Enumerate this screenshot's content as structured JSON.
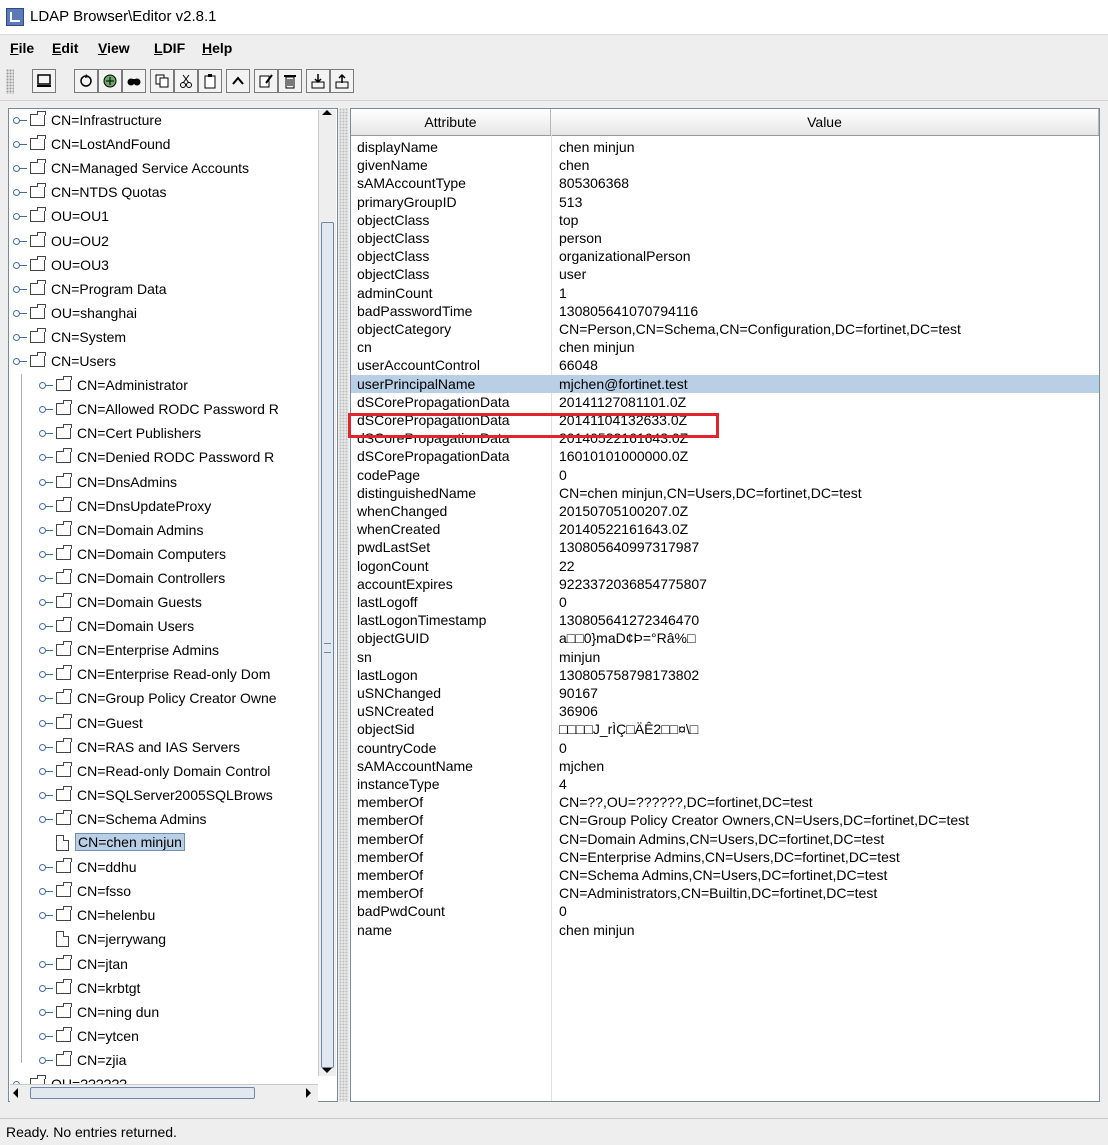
{
  "window": {
    "title": "LDAP Browser\\Editor v2.8.1"
  },
  "menu": [
    "File",
    "Edit",
    "View",
    "LDIF",
    "Help"
  ],
  "toolbar": {
    "buttons": [
      "computer-icon",
      "refresh-icon",
      "connect-icon",
      "search-icon",
      "copy-icon",
      "cut-icon",
      "paste-icon",
      "up-icon",
      "edit-icon",
      "delete-icon",
      "import-icon",
      "export-icon"
    ]
  },
  "tree": {
    "top": [
      "CN=Infrastructure",
      "CN=LostAndFound",
      "CN=Managed Service Accounts",
      "CN=NTDS Quotas",
      "OU=OU1",
      "OU=OU2",
      "OU=OU3",
      "CN=Program Data",
      "OU=shanghai",
      "CN=System",
      "CN=Users"
    ],
    "children": [
      {
        "label": "CN=Administrator",
        "type": "folder"
      },
      {
        "label": "CN=Allowed RODC Password R",
        "type": "folder"
      },
      {
        "label": "CN=Cert Publishers",
        "type": "folder"
      },
      {
        "label": "CN=Denied RODC Password R",
        "type": "folder"
      },
      {
        "label": "CN=DnsAdmins",
        "type": "folder"
      },
      {
        "label": "CN=DnsUpdateProxy",
        "type": "folder"
      },
      {
        "label": "CN=Domain Admins",
        "type": "folder"
      },
      {
        "label": "CN=Domain Computers",
        "type": "folder"
      },
      {
        "label": "CN=Domain Controllers",
        "type": "folder"
      },
      {
        "label": "CN=Domain Guests",
        "type": "folder"
      },
      {
        "label": "CN=Domain Users",
        "type": "folder"
      },
      {
        "label": "CN=Enterprise Admins",
        "type": "folder"
      },
      {
        "label": "CN=Enterprise Read-only Dom",
        "type": "folder"
      },
      {
        "label": "CN=Group Policy Creator Owne",
        "type": "folder"
      },
      {
        "label": "CN=Guest",
        "type": "folder"
      },
      {
        "label": "CN=RAS and IAS Servers",
        "type": "folder"
      },
      {
        "label": "CN=Read-only Domain Control",
        "type": "folder"
      },
      {
        "label": "CN=SQLServer2005SQLBrows",
        "type": "folder"
      },
      {
        "label": "CN=Schema Admins",
        "type": "folder"
      },
      {
        "label": "CN=chen minjun",
        "type": "leaf",
        "selected": true
      },
      {
        "label": "CN=ddhu",
        "type": "folder"
      },
      {
        "label": "CN=fsso",
        "type": "folder"
      },
      {
        "label": "CN=helenbu",
        "type": "folder"
      },
      {
        "label": "CN=jerrywang",
        "type": "leaf"
      },
      {
        "label": "CN=jtan",
        "type": "folder"
      },
      {
        "label": "CN=krbtgt",
        "type": "folder"
      },
      {
        "label": "CN=ning dun",
        "type": "folder"
      },
      {
        "label": "CN=ytcen",
        "type": "folder"
      },
      {
        "label": "CN=zjia",
        "type": "folder"
      }
    ],
    "bottom": [
      "OU=??????"
    ]
  },
  "table": {
    "columns": [
      "Attribute",
      "Value"
    ],
    "rows": [
      [
        "displayName",
        "chen minjun"
      ],
      [
        "givenName",
        "chen"
      ],
      [
        "sAMAccountType",
        "805306368"
      ],
      [
        "primaryGroupID",
        "513"
      ],
      [
        "objectClass",
        "top"
      ],
      [
        "objectClass",
        "person"
      ],
      [
        "objectClass",
        "organizationalPerson"
      ],
      [
        "objectClass",
        "user"
      ],
      [
        "adminCount",
        "1"
      ],
      [
        "badPasswordTime",
        "130805641070794116"
      ],
      [
        "objectCategory",
        "CN=Person,CN=Schema,CN=Configuration,DC=fortinet,DC=test"
      ],
      [
        "cn",
        "chen minjun"
      ],
      [
        "userAccountControl",
        "66048"
      ],
      [
        "userPrincipalName",
        "mjchen@fortinet.test"
      ],
      [
        "dSCorePropagationData",
        "20141127081101.0Z"
      ],
      [
        "dSCorePropagationData",
        "20141104132633.0Z"
      ],
      [
        "dSCorePropagationData",
        "20140522161643.0Z"
      ],
      [
        "dSCorePropagationData",
        "16010101000000.0Z"
      ],
      [
        "codePage",
        "0"
      ],
      [
        "distinguishedName",
        "CN=chen minjun,CN=Users,DC=fortinet,DC=test"
      ],
      [
        "whenChanged",
        "20150705100207.0Z"
      ],
      [
        "whenCreated",
        "20140522161643.0Z"
      ],
      [
        "pwdLastSet",
        "130805640997317987"
      ],
      [
        "logonCount",
        "22"
      ],
      [
        "accountExpires",
        "9223372036854775807"
      ],
      [
        "lastLogoff",
        "0"
      ],
      [
        "lastLogonTimestamp",
        "130805641272346470"
      ],
      [
        "objectGUID",
        "a□□0}maD¢Þ=°Râ%□"
      ],
      [
        "sn",
        "minjun"
      ],
      [
        "lastLogon",
        "130805758798173802"
      ],
      [
        "uSNChanged",
        "90167"
      ],
      [
        "uSNCreated",
        "36906"
      ],
      [
        "objectSid",
        "□□□□J_rÌÇ□ÄÊ2□□¤\\□"
      ],
      [
        "countryCode",
        "0"
      ],
      [
        "sAMAccountName",
        "mjchen"
      ],
      [
        "instanceType",
        "4"
      ],
      [
        "memberOf",
        "CN=??,OU=??????,DC=fortinet,DC=test"
      ],
      [
        "memberOf",
        "CN=Group Policy Creator Owners,CN=Users,DC=fortinet,DC=test"
      ],
      [
        "memberOf",
        "CN=Domain Admins,CN=Users,DC=fortinet,DC=test"
      ],
      [
        "memberOf",
        "CN=Enterprise Admins,CN=Users,DC=fortinet,DC=test"
      ],
      [
        "memberOf",
        "CN=Schema Admins,CN=Users,DC=fortinet,DC=test"
      ],
      [
        "memberOf",
        "CN=Administrators,CN=Builtin,DC=fortinet,DC=test"
      ],
      [
        "badPwdCount",
        "0"
      ],
      [
        "name",
        "chen minjun"
      ]
    ],
    "selected_row": 13
  },
  "status": {
    "text": "Ready. No entries returned."
  }
}
